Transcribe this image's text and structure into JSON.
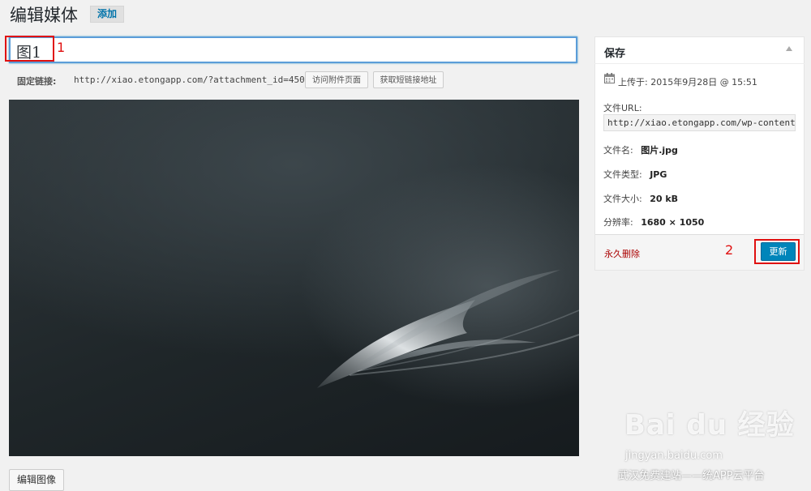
{
  "header": {
    "title": "编辑媒体",
    "add_label": "添加"
  },
  "title_field": {
    "value": "图1"
  },
  "annotations": {
    "one": "1",
    "two": "2"
  },
  "permalink": {
    "label": "固定链接:",
    "url": "http://xiao.etongapp.com/?attachment_id=450",
    "view_button": "访问附件页面",
    "get_link_button": "获取短链接地址"
  },
  "edit_image_label": "编辑图像",
  "save_box": {
    "title": "保存",
    "uploaded_on": "上传于: 2015年9月28日 @ 15:51",
    "file_url_label": "文件URL:",
    "file_url_value": "http://xiao.etongapp.com/wp-content",
    "file_name_label": "文件名:",
    "file_name_value": "图片.jpg",
    "file_type_label": "文件类型:",
    "file_type_value": "JPG",
    "file_size_label": "文件大小:",
    "file_size_value": "20 kB",
    "dimensions_label": "分辨率:",
    "dimensions_value": "1680 × 1050",
    "delete_label": "永久删除",
    "update_label": "更新"
  },
  "watermark": {
    "logo": "Bai du 经验",
    "url": "jingyan.baidu.com",
    "caption": "武汉免费建站——统APP云平台"
  },
  "colors": {
    "primary_button": "#0085ba",
    "highlight_box": "#e01010",
    "link_delete": "#a00000"
  },
  "icons": {
    "calendar": "calendar-icon",
    "toggle": "arrow-up-icon"
  }
}
